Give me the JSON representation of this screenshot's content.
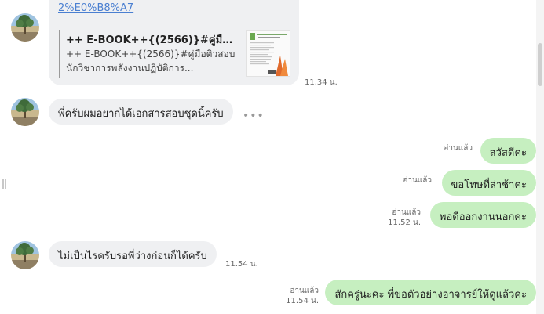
{
  "link_message": {
    "url_text": "2%E0%B8%A7",
    "preview_title": "++ E-BOOK++{(2566)}#คู่มือติวสอ...",
    "preview_desc_line1": "++ E-BOOK++{(2566)}#คู่มือติวสอบ",
    "preview_desc_line2": "นักวิชาการพลังงานปฏิบัติการ...",
    "time": "11.34 น."
  },
  "messages": [
    {
      "side": "in",
      "text": "พี่ครับผมอยากได้เอกสารสอบชุดนี้ครับ"
    },
    {
      "side": "out",
      "read": "อ่านแล้ว",
      "text": "สวัสดีคะ"
    },
    {
      "side": "out",
      "read": "อ่านแล้ว",
      "text": "ขอโทษที่ล่าช้าคะ"
    },
    {
      "side": "out",
      "read": "อ่านแล้ว",
      "time": "11.52 น.",
      "text": "พอดีออกงานนอกคะ"
    },
    {
      "side": "in",
      "text": "ไม่เป็นไรครับรอพี่ว่างก่อนก็ได้ครับ",
      "time": "11.54 น."
    },
    {
      "side": "out",
      "read": "อ่านแล้ว",
      "time": "11.54 น.",
      "text": "สักครู่นะคะ พี่ขอตัวอย่างอาจารย์ให้ดูแล้วคะ"
    }
  ],
  "more_icon": "ellipsis-icon",
  "colors": {
    "incoming_bubble": "#eff0f2",
    "outgoing_bubble": "#c6efc0",
    "link": "#4a7fd1"
  }
}
